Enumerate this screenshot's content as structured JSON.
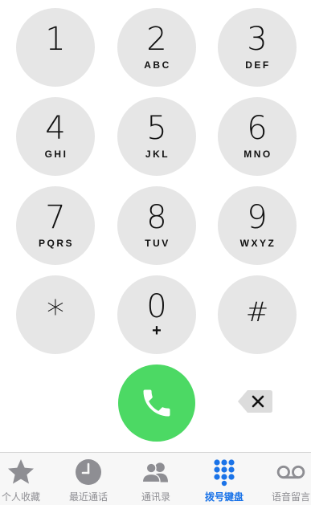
{
  "keypad": {
    "keys": [
      {
        "digit": "1",
        "letters": ""
      },
      {
        "digit": "2",
        "letters": "ABC"
      },
      {
        "digit": "3",
        "letters": "DEF"
      },
      {
        "digit": "4",
        "letters": "GHI"
      },
      {
        "digit": "5",
        "letters": "JKL"
      },
      {
        "digit": "6",
        "letters": "MNO"
      },
      {
        "digit": "7",
        "letters": "PQRS"
      },
      {
        "digit": "8",
        "letters": "TUV"
      },
      {
        "digit": "9",
        "letters": "WXYZ"
      },
      {
        "digit": "*",
        "letters": ""
      },
      {
        "digit": "0",
        "letters": "+"
      },
      {
        "digit": "#",
        "letters": ""
      }
    ]
  },
  "actions": {
    "call_icon": "phone-icon",
    "delete_icon": "backspace-icon",
    "call_color": "#4cd964"
  },
  "tab_bar": {
    "active_color": "#1a73e8",
    "inactive_color": "#8e8e93",
    "tabs": [
      {
        "label": "个人收藏",
        "icon": "star-icon"
      },
      {
        "label": "最近通话",
        "icon": "clock-icon"
      },
      {
        "label": "通讯录",
        "icon": "contacts-icon"
      },
      {
        "label": "拨号键盘",
        "icon": "keypad-icon",
        "active": true
      },
      {
        "label": "语音留言",
        "icon": "voicemail-icon"
      }
    ]
  }
}
